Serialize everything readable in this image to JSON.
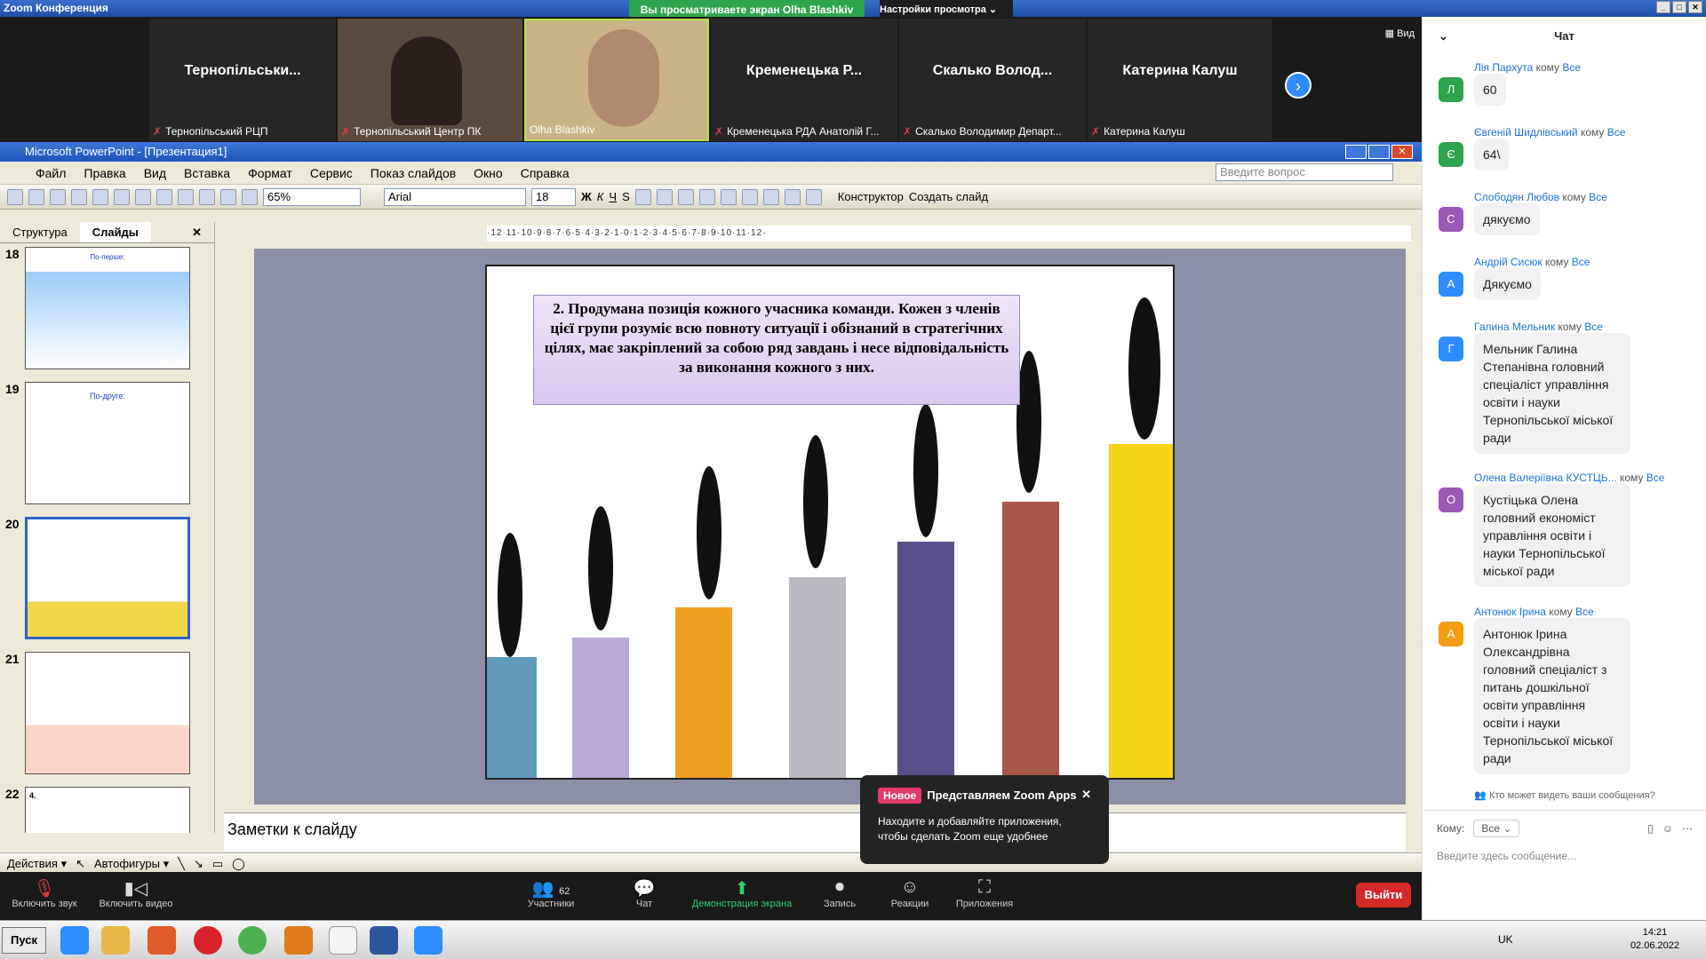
{
  "window": {
    "title": "Zoom Конференция",
    "viewing": "Вы просматриваете экран Olha Blashkiv",
    "view_options": "Настройки просмотра ⌄"
  },
  "gallery": {
    "view_label": "Вид",
    "tiles": [
      {
        "big": "Тернопільськи...",
        "name": "Тернопільський РЦП",
        "muted": true
      },
      {
        "big": "",
        "name": "Тернопільський Центр ПК",
        "muted": true
      },
      {
        "big": "",
        "name": "Olha Blashkiv",
        "muted": false
      },
      {
        "big": "Кременецька Р...",
        "name": "Кременецька РДА Анатолій Г...",
        "muted": true
      },
      {
        "big": "Скалько Волод...",
        "name": "Скалько Володимир Департ...",
        "muted": true
      },
      {
        "big": "Катерина Калуш",
        "name": "Катерина Калуш",
        "muted": true
      }
    ]
  },
  "ppt": {
    "title": "Microsoft PowerPoint - [Презентация1]",
    "menu": [
      "Файл",
      "Правка",
      "Вид",
      "Вставка",
      "Формат",
      "Сервис",
      "Показ слайдов",
      "Окно",
      "Справка"
    ],
    "question_placeholder": "Введите вопрос",
    "zoom": "65%",
    "font": "Arial",
    "size": "18",
    "fmt_buttons": [
      "Ж",
      "К",
      "Ч",
      "S"
    ],
    "designer": "Конструктор",
    "new_slide": "Создать слайд",
    "tabs": [
      "Структура",
      "Слайды"
    ],
    "thumbs": [
      {
        "num": "18"
      },
      {
        "num": "19"
      },
      {
        "num": "20"
      },
      {
        "num": "21"
      },
      {
        "num": "22"
      }
    ],
    "thumb_titles": [
      "По-перше:",
      "По-друге:",
      "4."
    ],
    "ruler": "·12·11·10·9·8·7·6·5·4·3·2·1·0·1·2·3·4·5·6·7·8·9·10·11·12·",
    "slide_text": "2. Продумана позиція кожного учасника команди. Кожен з членів цієї групи розуміє всю повноту ситуації і обізнаний в стратегічних цілях, має закріплений за собою ряд завдань і несе відповідальність за виконання кожного з них.",
    "notes": "Заметки к слайду",
    "draw_actions": "Действия ▾",
    "autoshapes": "Автофигуры ▾"
  },
  "zoombar": {
    "mute": "Включить звук",
    "video": "Включить видео",
    "participants": "Участники",
    "count": "62",
    "chat": "Чат",
    "share": "Демонстрация экрана",
    "record": "Запись",
    "reactions": "Реакции",
    "apps": "Приложения",
    "leave": "Выйти"
  },
  "popup": {
    "badge": "Новое",
    "title": "Представляем Zoom Apps",
    "body": "Находите и добавляйте приложения, чтобы сделать Zoom еще удобнее"
  },
  "chat": {
    "title": "Чат",
    "to_word": "кому",
    "messages": [
      {
        "from": "Лія Пархута",
        "to": "Все",
        "initial": "Л",
        "color": "#2fa44f",
        "text": "60"
      },
      {
        "from": "Євгеній Шидлівський",
        "to": "Все",
        "initial": "Є",
        "color": "#2fa44f",
        "text": "64\\"
      },
      {
        "from": "Слободян  Любов",
        "to": "Все",
        "initial": "С",
        "color": "#9b59b6",
        "text": "дякуємо"
      },
      {
        "from": "Андрій Сисюк",
        "to": "Все",
        "initial": "А",
        "color": "#2d8cff",
        "text": "Дякуємо"
      },
      {
        "from": "Галина Мельник",
        "to": "Все",
        "initial": "Г",
        "color": "#2d8cff",
        "text": "Мельник Галина Степанівна головний спеціаліст управління освіти і науки Тернопільської міської ради"
      },
      {
        "from": "Олена  Валеріївна КУСТЦЬ...",
        "to": "Все",
        "initial": "О",
        "color": "#9b59b6",
        "text": "Кустіцька Олена головний економіст управління освіти і науки Тернопільської міської ради"
      },
      {
        "from": "Антонюк Ірина",
        "to": "Все",
        "initial": "А",
        "color": "#f39c12",
        "text": "Антонюк Ірина Олександрівна головний спеціаліст з питань дошкільної освіти  управління освіти і науки Тернопільської міської ради"
      }
    ],
    "who_can_see": "Кто может видеть ваши сообщения?",
    "to_label": "Кому:",
    "to_value": "Все ⌄",
    "placeholder": "Введите здесь сообщение..."
  },
  "taskbar": {
    "start": "Пуск",
    "lang": "UK",
    "time": "14:21",
    "date": "02.06.2022"
  }
}
